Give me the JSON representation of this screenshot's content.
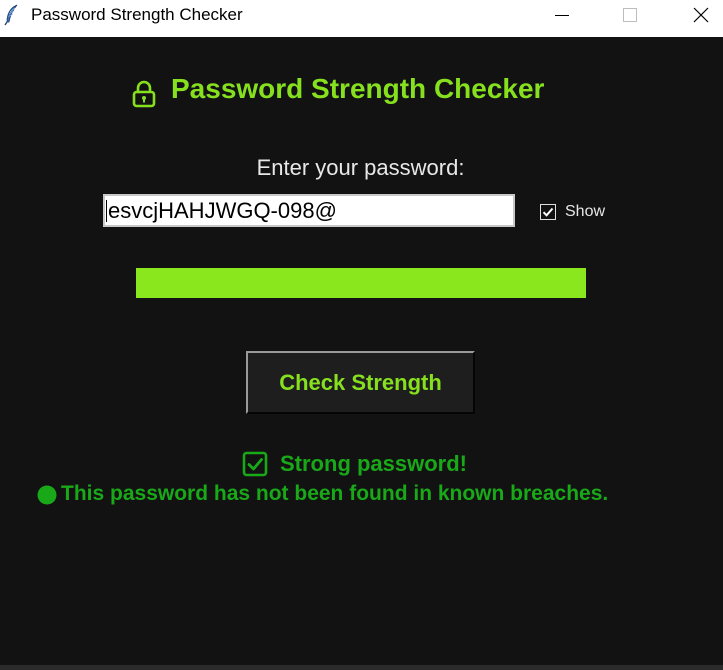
{
  "window": {
    "title": "Password Strength Checker"
  },
  "header": {
    "title": "Password Strength Checker",
    "icon": "lock-icon"
  },
  "form": {
    "prompt": "Enter your password:",
    "password_value": "esvcjHAHJWGQ-098@",
    "show_label": "Show",
    "show_checked": true,
    "strength_fraction": 1.0,
    "check_button_label": "Check Strength"
  },
  "results": {
    "strength_message": "Strong password!",
    "breach_message": "This password has not been found in known breaches."
  },
  "colors": {
    "background": "#121212",
    "accent": "#86e01e",
    "strength_bar": "#8ae61d",
    "success": "#18a818"
  }
}
